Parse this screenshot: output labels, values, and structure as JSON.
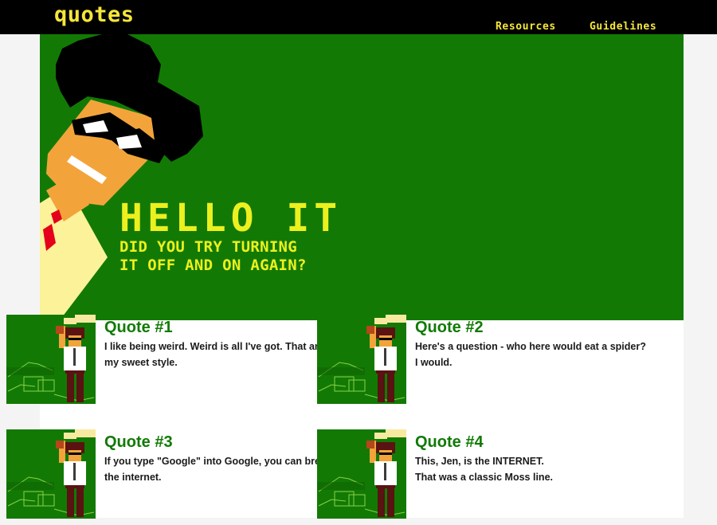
{
  "header": {
    "logo": "quotes",
    "nav": [
      {
        "label": "Resources",
        "active": true
      },
      {
        "label": "Guidelines",
        "active": false
      }
    ]
  },
  "hero": {
    "title": "HELLO IT",
    "subtitle_line1": "DID YOU TRY TURNING",
    "subtitle_line2": "IT OFF AND ON AGAIN?"
  },
  "quotes": [
    {
      "title": "Quote #1",
      "lines": [
        "I like being weird. Weird is all I've got. That and",
        "my sweet style."
      ]
    },
    {
      "title": "Quote #2",
      "lines": [
        "Here's a question - who here would eat a spider?",
        "I would."
      ]
    },
    {
      "title": "Quote #3",
      "lines": [
        "If you type \"Google\" into Google, you can break",
        "the internet."
      ]
    },
    {
      "title": "Quote #4",
      "lines": [
        "This, Jen, is the INTERNET.",
        "That was a classic Moss line."
      ]
    }
  ],
  "colors": {
    "accent_yellow": "#f5e63a",
    "hero_green": "#127a04",
    "title_green": "#117a05"
  }
}
